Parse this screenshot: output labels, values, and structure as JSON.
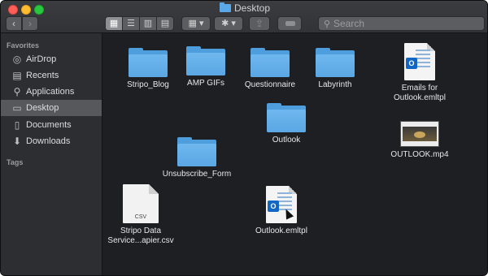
{
  "window": {
    "title": "Desktop"
  },
  "toolbar": {
    "back_label": "‹",
    "forward_label": "›",
    "view_icons": [
      "▦",
      "☰",
      "▥",
      "▤"
    ],
    "arrange_label": "▦ ▾",
    "action_label": "✱ ▾",
    "share_label": "⇪",
    "search_placeholder": "Search"
  },
  "sidebar": {
    "favorites_heading": "Favorites",
    "tags_heading": "Tags",
    "items": [
      {
        "label": "AirDrop",
        "icon": "airdrop-icon",
        "glyph": "◎"
      },
      {
        "label": "Recents",
        "icon": "recents-icon",
        "glyph": "▤"
      },
      {
        "label": "Applications",
        "icon": "applications-icon",
        "glyph": "⚲"
      },
      {
        "label": "Desktop",
        "icon": "desktop-icon",
        "glyph": "▭",
        "selected": true
      },
      {
        "label": "Documents",
        "icon": "documents-icon",
        "glyph": "▯"
      },
      {
        "label": "Downloads",
        "icon": "downloads-icon",
        "glyph": "⬇"
      }
    ]
  },
  "files": [
    {
      "name": "Stripo_Blog",
      "kind": "folder"
    },
    {
      "name": "AMP GIFs",
      "kind": "folder"
    },
    {
      "name": "Questionnaire",
      "kind": "folder"
    },
    {
      "name": "Labyrinth",
      "kind": "folder"
    },
    {
      "name": "Emails for Outlook.emltpl",
      "kind": "outlook-template"
    },
    {
      "name": "Outlook",
      "kind": "folder"
    },
    {
      "name": "OUTLOOK.mp4",
      "kind": "video"
    },
    {
      "name": "Unsubscribe_Form",
      "kind": "folder"
    },
    {
      "name": "Stripo Data Service...apier.csv",
      "kind": "csv",
      "ext": "CSV"
    },
    {
      "name": "Outlook.emltpl",
      "kind": "outlook-template"
    }
  ],
  "colors": {
    "folder": "#5aa7e4",
    "selection": "#57585c",
    "outlook": "#1266c4"
  }
}
